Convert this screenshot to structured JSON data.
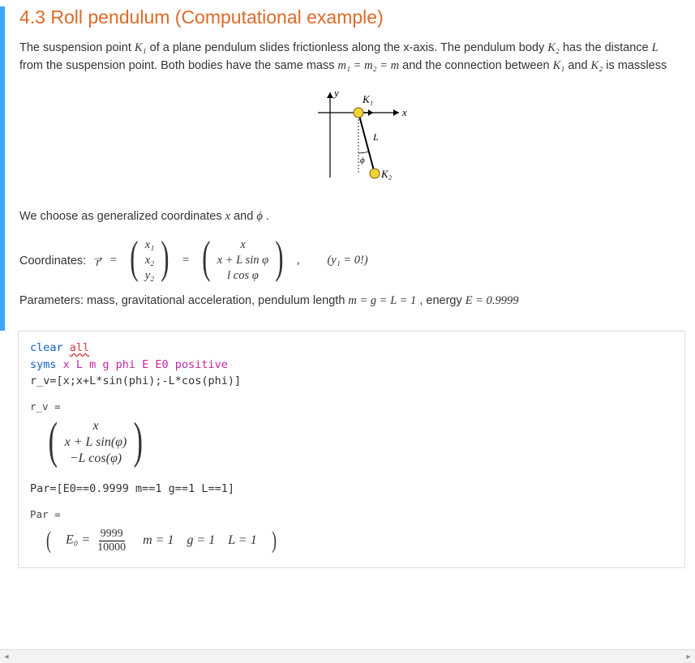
{
  "heading": "4.3 Roll pendulum (Computational example)",
  "intro": {
    "pre": "The suspension point ",
    "k1": "K₁",
    "mid1": " of a plane pendulum slides frictionless along the x-axis. The pendulum body ",
    "k2": "K₂",
    "mid2": " has the distance ",
    "L": "L",
    "mid3": " from the suspension point. Both bodies have the same mass ",
    "mass_eq": "m₁ = m₂ = m",
    "mid4": " and the connection between ",
    "k1b": "K₁",
    "and": " and ",
    "k2b": "K₂",
    "tail": " is massless"
  },
  "diagram": {
    "y_axis": "y",
    "x_axis": "x",
    "K1": "K₁",
    "K2": "K₂",
    "L_label": "L",
    "phi_label": "ϕ"
  },
  "gencoord": {
    "text_pre": "We choose as generalized coordinates ",
    "x": "x",
    "and": " and ",
    "phi": "ϕ",
    "dot": " ."
  },
  "coord_line": {
    "label": "Coordinates: ",
    "r": "r",
    "eq": " = ",
    "v1a": "x₁",
    "v1b": "x₂",
    "v1c": "y₂",
    "v2a": "x",
    "v2b": "x + L sin φ",
    "v2c": "l cos φ",
    "note": "(y₁ = 0!)"
  },
  "param_line": {
    "pre": "Parameters: mass, gravitational acceleration, pendulum length ",
    "eq": "m = g = L = 1",
    "mid": ", energy ",
    "energy": "E = 0.9999"
  },
  "code": {
    "l1a": "clear ",
    "l1b": "all",
    "l2a": "syms ",
    "l2b": "x L m g phi E E0 positive",
    "l3": "r_v=[x;x+L*sin(phi);-L*cos(phi)]",
    "l4": "Par=[E0==0.9999 m==1 g==1 L==1]"
  },
  "out_rv": {
    "label": "r_v =",
    "r1": "x",
    "r2": "x + L sin(φ)",
    "r3": "−L cos(φ)"
  },
  "out_par": {
    "label": "Par =",
    "e0": "E₀ = ",
    "num": "9999",
    "den": "10000",
    "m": "m = 1",
    "g": "g = 1",
    "L": "L = 1"
  },
  "scrollbar": {
    "left": "◂",
    "right": "▸"
  }
}
